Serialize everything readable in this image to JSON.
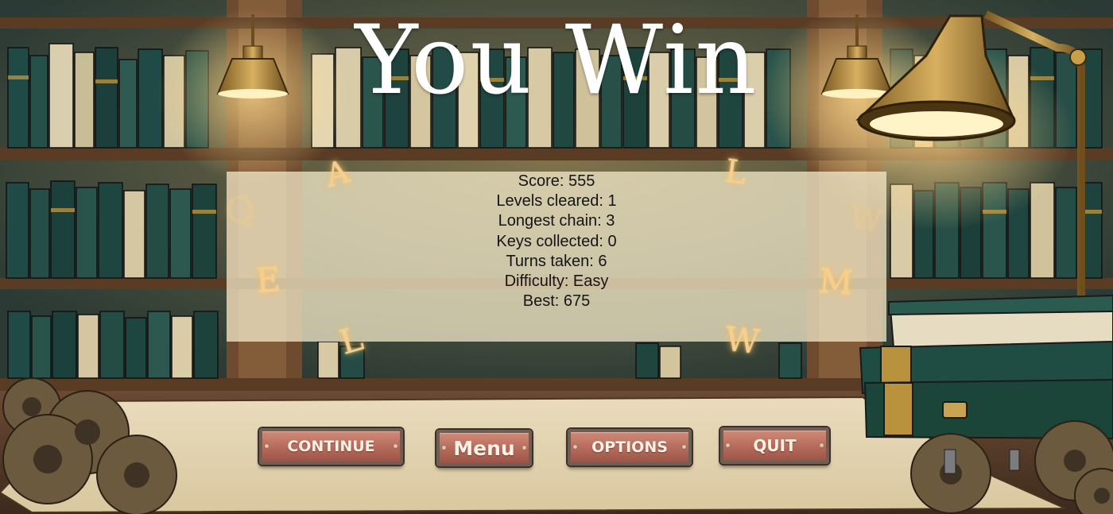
{
  "title": "You Win",
  "stats": [
    "Score: 555",
    "Levels cleared: 1",
    "Longest chain: 3",
    "Keys collected: 0",
    "Turns taken: 6",
    "Difficulty: Easy",
    "Best: 675"
  ],
  "buttons": {
    "continue": "CONTINUE",
    "menu": "Menu",
    "options": "OPTIONS",
    "quit": "QUIT"
  },
  "floating_letters": [
    "A",
    "L",
    "Q",
    "W",
    "E",
    "M",
    "L",
    "W"
  ],
  "colors": {
    "title": "#ffffff",
    "panel": "#f6eccc",
    "button": "#b56a5a",
    "button_text": "#fbf1e6",
    "letter_glow": "#f6cf8e"
  }
}
